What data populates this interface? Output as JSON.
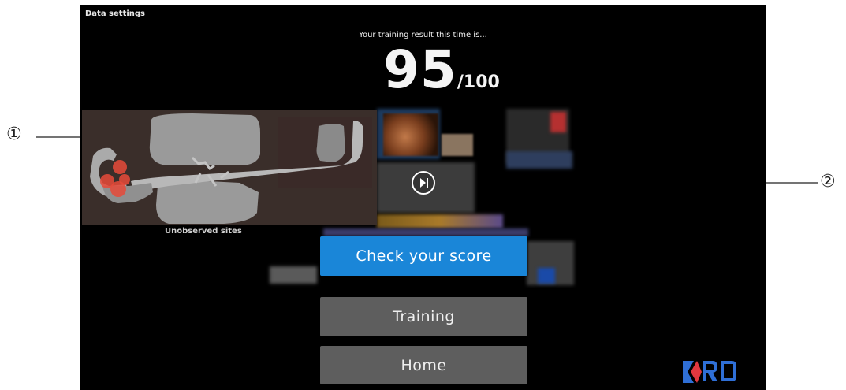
{
  "app": {
    "data_settings": "Data settings",
    "result_text": "Your training result this time is...",
    "score_value": "95",
    "score_max": "/100",
    "unobserved_label": "Unobserved sites"
  },
  "buttons": {
    "check_score": "Check your score",
    "training": "Training",
    "home": "Home"
  },
  "callouts": {
    "one": "①",
    "two": "②"
  },
  "logo": {
    "text": "RO",
    "icon": "k-logo-icon"
  },
  "colors": {
    "primary_button": "#1a86d8",
    "secondary_button": "#5e5e5e",
    "observed_marker": "#e84a3a",
    "logo_blue": "#2f6fd6",
    "logo_red": "#e0373f"
  }
}
